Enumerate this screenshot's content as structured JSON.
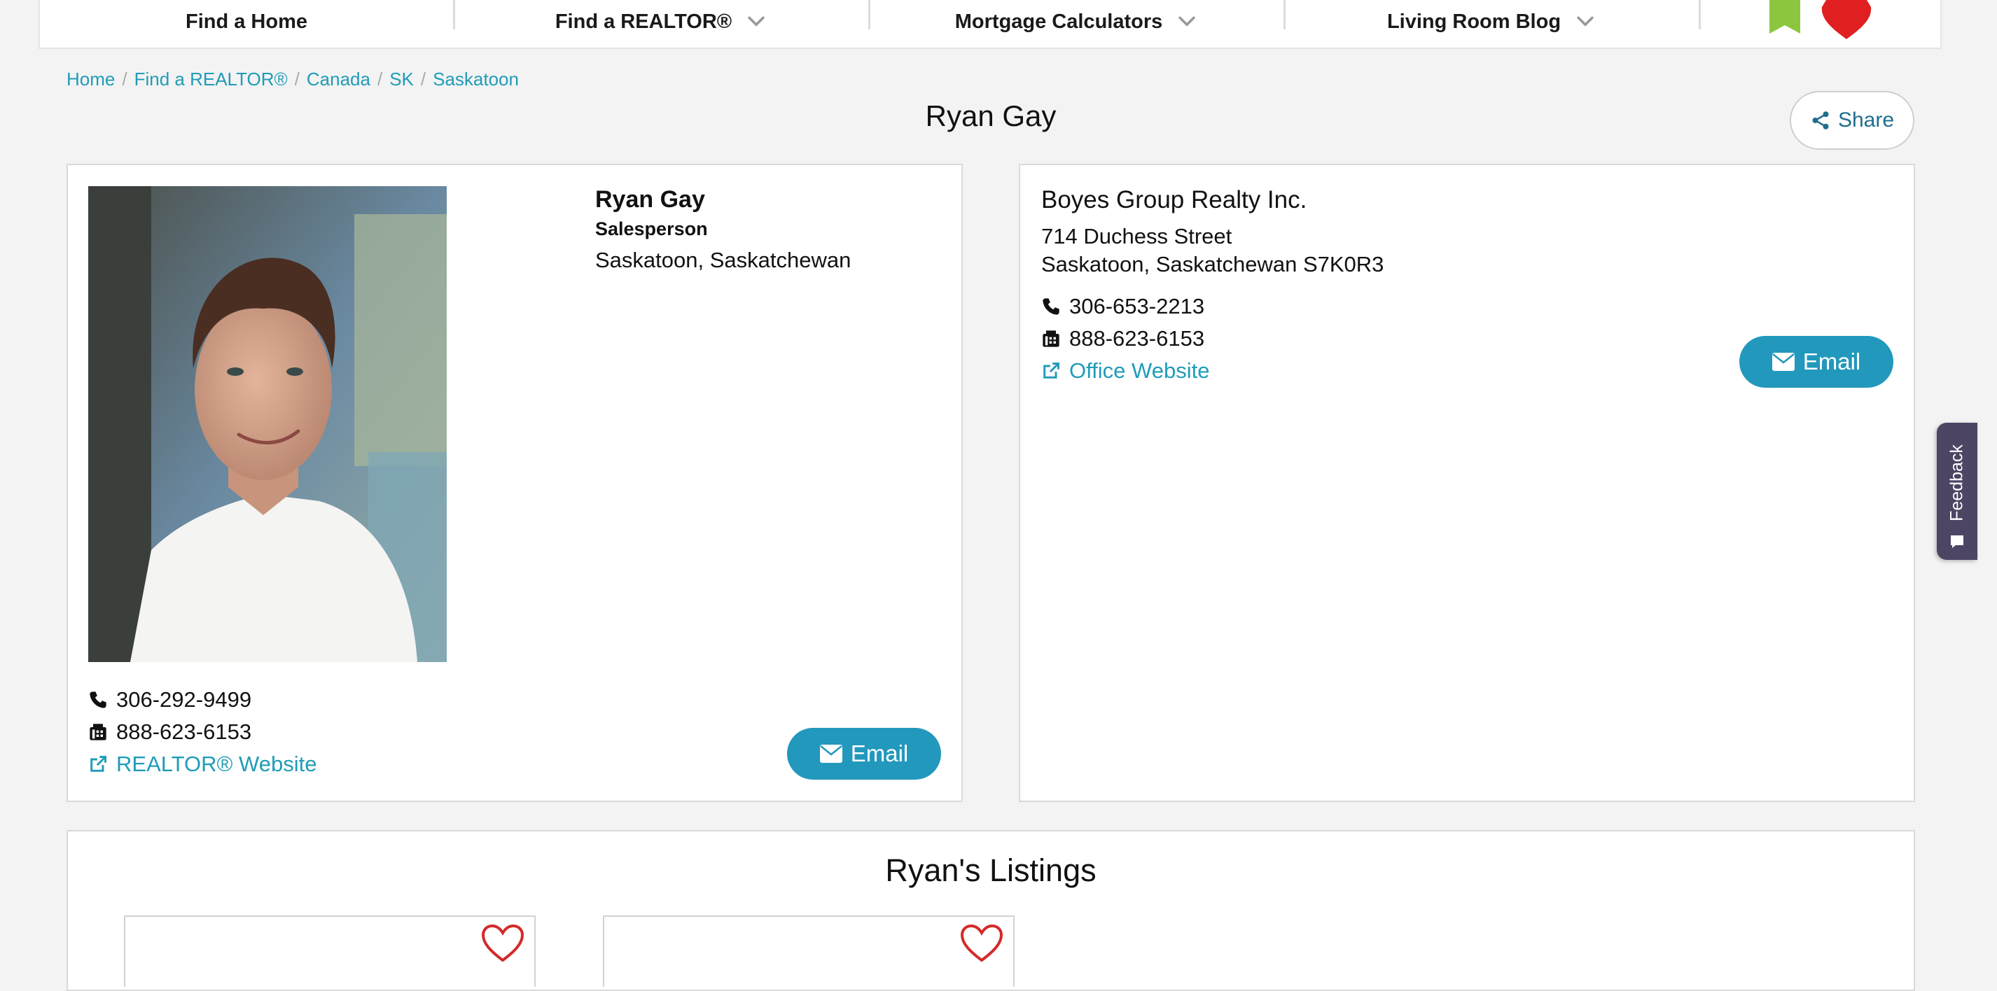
{
  "nav": {
    "items": [
      {
        "label": "Find a Home",
        "has_dropdown": false
      },
      {
        "label": "Find a REALTOR®",
        "has_dropdown": true
      },
      {
        "label": "Mortgage Calculators",
        "has_dropdown": true
      },
      {
        "label": "Living Room Blog",
        "has_dropdown": true
      }
    ],
    "icons": [
      "bookmark-icon",
      "heart-icon"
    ]
  },
  "breadcrumb": [
    "Home",
    "Find a REALTOR®",
    "Canada",
    "SK",
    "Saskatoon"
  ],
  "page": {
    "title": "Ryan Gay",
    "share_label": "Share"
  },
  "agent": {
    "name": "Ryan Gay",
    "role": "Salesperson",
    "location": "Saskatoon, Saskatchewan",
    "phone": "306-292-9499",
    "fax": "888-623-6153",
    "website_label": "REALTOR® Website",
    "email_label": "Email"
  },
  "office": {
    "name": "Boyes Group Realty Inc.",
    "street": "714 Duchess Street",
    "city": "Saskatoon, Saskatchewan S7K0R3",
    "phone": "306-653-2213",
    "fax": "888-623-6153",
    "website_label": "Office Website",
    "email_label": "Email"
  },
  "feedback": {
    "label": "Feedback"
  },
  "listings": {
    "title": "Ryan's Listings",
    "count_visible": 2
  },
  "colors": {
    "accent": "#2298bd",
    "link": "#1f9cb8",
    "bookmark": "#8cc63f",
    "heart": "#e02020",
    "feedback_bg": "#4c4563"
  }
}
